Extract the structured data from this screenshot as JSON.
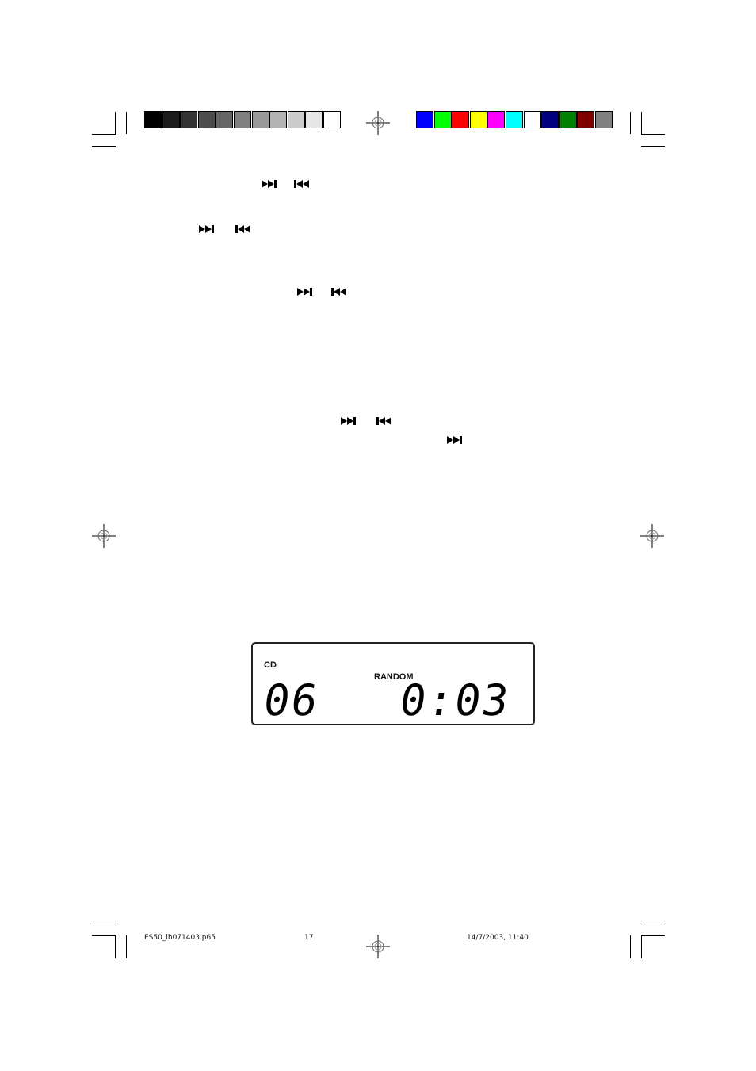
{
  "color_bar": {
    "grays": [
      "#000000",
      "#1c1c1c",
      "#333333",
      "#4d4d4d",
      "#666666",
      "#808080",
      "#999999",
      "#b3b3b3",
      "#cccccc",
      "#e6e6e6",
      "#ffffff"
    ],
    "colors": [
      "#0000ff",
      "#00ff00",
      "#ff0000",
      "#ffff00",
      "#ff00ff",
      "#00ffff",
      "#ffffff",
      "#000080",
      "#008000",
      "#800000",
      "#808080"
    ]
  },
  "icons": [
    "skip-next-icon",
    "skip-previous-icon"
  ],
  "lcd": {
    "source_label": "CD",
    "mode_label": "RANDOM",
    "track": "06",
    "time": "0:03"
  },
  "footer": {
    "filename": "ES50_ib071403.p65",
    "page_number": "17",
    "datetime": "14/7/2003, 11:40"
  }
}
